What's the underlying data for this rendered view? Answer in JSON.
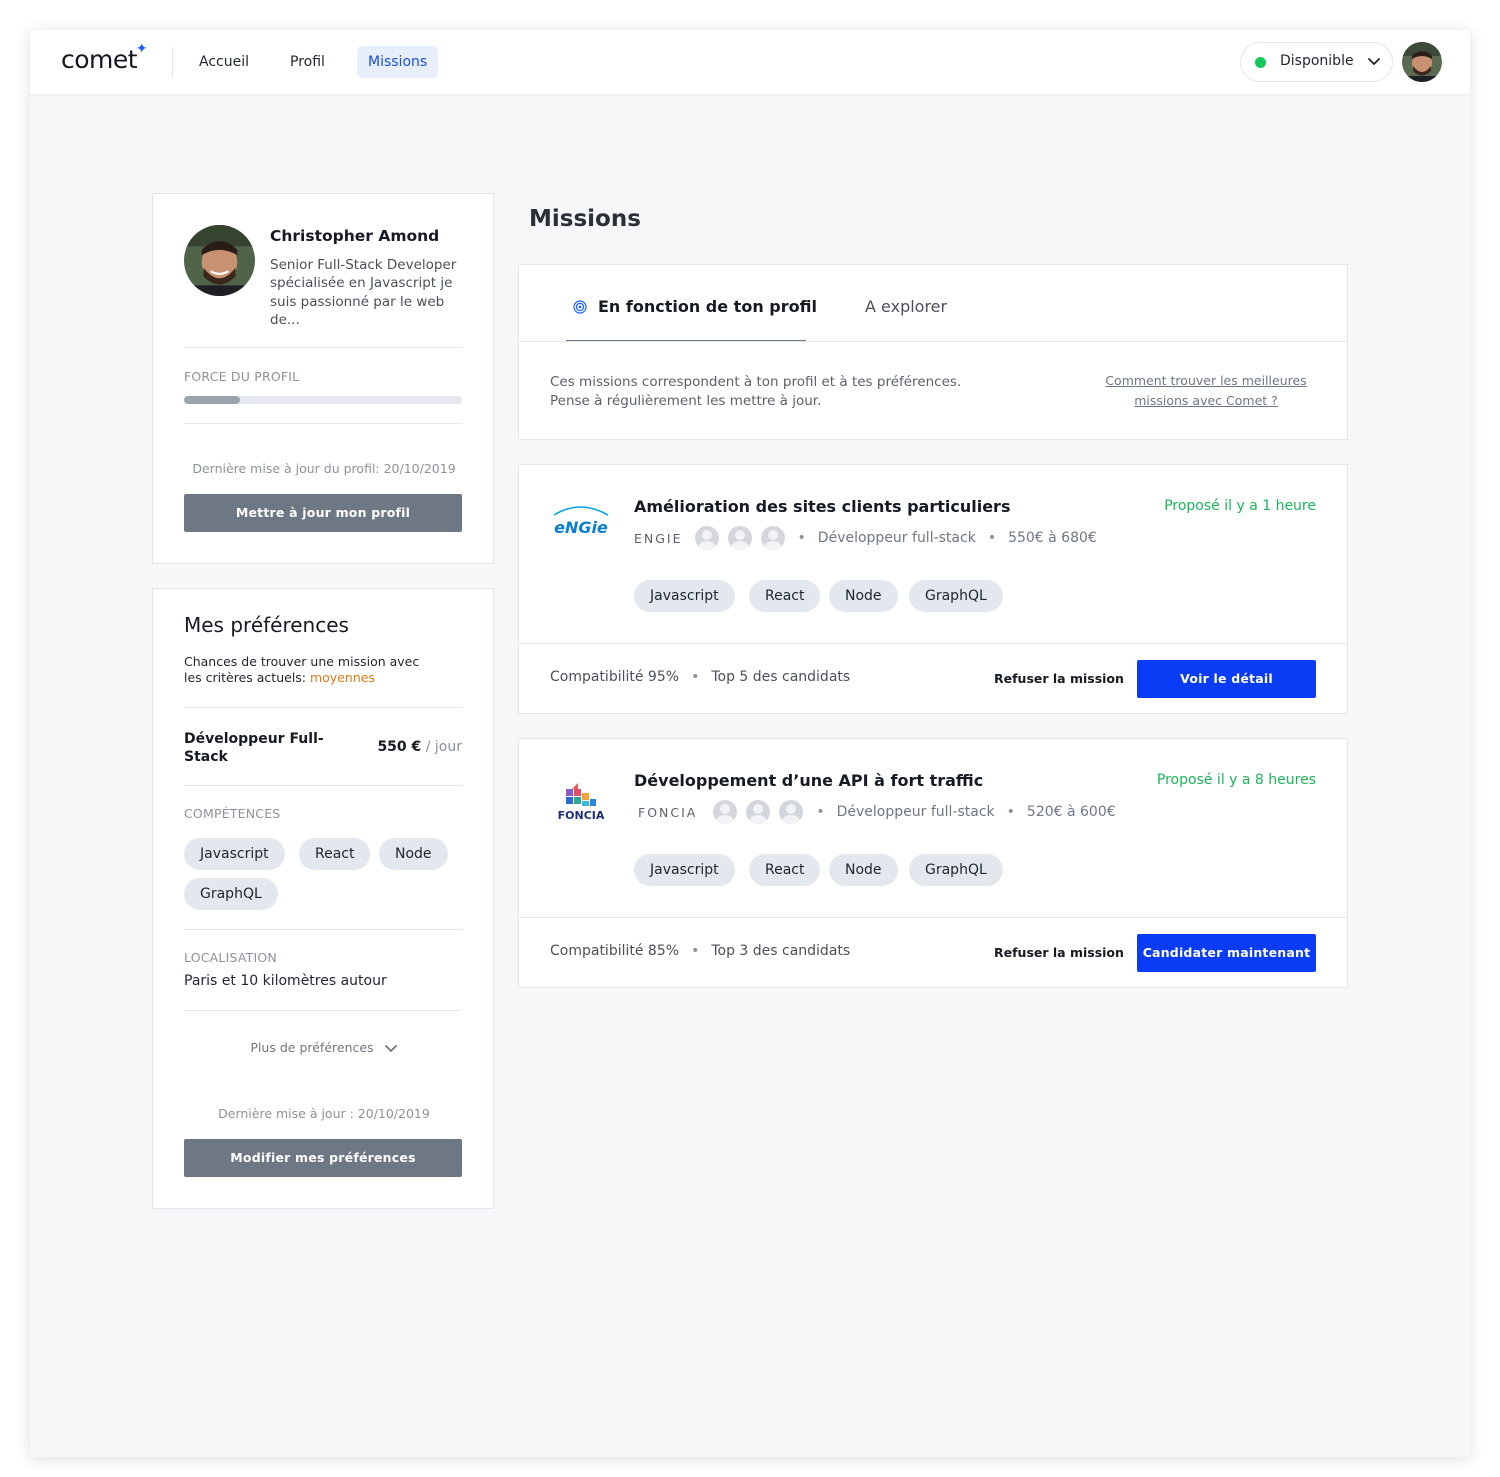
{
  "nav": {
    "logo": "comet",
    "items": [
      {
        "label": "Accueil"
      },
      {
        "label": "Profil"
      },
      {
        "label": "Missions"
      }
    ],
    "status": "Disponible"
  },
  "profile": {
    "name": "Christopher Amond",
    "bio": "Senior Full-Stack Developer spécialisée en Javascript je suis passionné par le web de...",
    "force_label": "FORCE DU PROFIL",
    "force_progress": 0.2,
    "last_update": "Dernière mise à jour du profil: 20/10/2019",
    "update_button": "Mettre à jour mon profil"
  },
  "preferences": {
    "title": "Mes préférences",
    "chances_text": "Chances de trouver une mission avec les critères actuels: ",
    "chances_level": "moyennes",
    "role": "Développeur Full-Stack",
    "rate": "550 €",
    "rate_unit": "/ jour",
    "skills_label": "COMPÉTENCES",
    "skills": [
      "Javascript",
      "React",
      "Node",
      "GraphQL"
    ],
    "location_label": "LOCALISATION",
    "location": "Paris et 10 kilomètres autour",
    "more": "Plus de préférences",
    "last_update": "Dernière mise à jour : 20/10/2019",
    "edit_button": "Modifier mes préférences"
  },
  "missions": {
    "title": "Missions",
    "tabs": [
      {
        "label": "En fonction de ton profil"
      },
      {
        "label": "A explorer"
      }
    ],
    "description_line1": "Ces missions correspondent à ton profil et à tes préférences.",
    "description_line2": "Pense à régulièrement les mettre à jour.",
    "help_link": "Comment trouver les meilleures missions avec Comet ?",
    "items": [
      {
        "title": "Amélioration des sites clients particuliers",
        "posted": "Proposé il y a 1 heure",
        "company": "ENGIE",
        "logo_text": "eNGie",
        "role": "Développeur full-stack",
        "rate": "550€ à 680€",
        "skills": [
          "Javascript",
          "React",
          "Node",
          "GraphQL"
        ],
        "compatibility": "Compatibilité 95%",
        "rank": "Top 5 des candidats",
        "refuse": "Refuser la mission",
        "action": "Voir le détail"
      },
      {
        "title": "Développement d’une API à fort traffic",
        "posted": "Proposé il y a 8 heures",
        "company": "FONCIA",
        "logo_text": "FONCIA",
        "role": "Développeur full-stack",
        "rate": "520€ à 600€",
        "skills": [
          "Javascript",
          "React",
          "Node",
          "GraphQL"
        ],
        "compatibility": "Compatibilité 85%",
        "rank": "Top 3 des candidats",
        "refuse": "Refuser la mission",
        "action": "Candidater maintenant"
      }
    ]
  },
  "colors": {
    "accent": "#0a3cf5",
    "status_green": "#14c95a",
    "posted_green": "#1bb55a",
    "level_orange": "#e07a13",
    "button_gray": "#6e7784"
  }
}
